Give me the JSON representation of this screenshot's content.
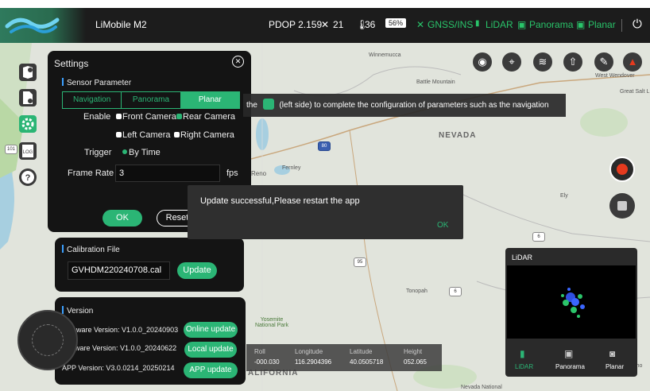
{
  "topbar": {
    "app_title": "LiMobile M2",
    "pdop": "PDOP 2.159",
    "satellites": "21",
    "temperature": "36",
    "battery": "56%",
    "gnss_label": "GNSS/INS",
    "lidar_label": "LiDAR",
    "panorama_label": "Panorama",
    "planar_label": "Planar"
  },
  "hint_banner": {
    "prefix": "the",
    "text": "(left side) to complete the configuration of parameters such as the navigation"
  },
  "settings": {
    "title": "Settings",
    "sensor_title": "Sensor Parameter",
    "tabs": [
      "Navigation",
      "Panorama",
      "Planar"
    ],
    "active_tab": "Planar",
    "enable_label": "Enable",
    "cameras": [
      {
        "label": "Front Camera",
        "checked": false
      },
      {
        "label": "Rear Camera",
        "checked": true
      },
      {
        "label": "Left Camera",
        "checked": false
      },
      {
        "label": "Right Camera",
        "checked": false
      }
    ],
    "trigger_label": "Trigger",
    "trigger_value": "By Time",
    "frame_rate_label": "Frame Rate",
    "frame_rate_value": "3",
    "frame_rate_unit": "fps",
    "ok_label": "OK",
    "reset_label": "Reset"
  },
  "calibration": {
    "title": "Calibration File",
    "file": "GVHDM220240708.cal",
    "update_label": "Update"
  },
  "version": {
    "title": "Version",
    "firmware": "Firmware Version: V1.0.0_20240903",
    "software": "Software Version: V1.0.0_20240622",
    "app": "APP Version: V3.0.0214_20250214",
    "online_update": "Online update",
    "local_update": "Local update",
    "app_update": "APP update"
  },
  "dialog": {
    "message": "Update successful,Please restart the app",
    "ok_label": "OK"
  },
  "telemetry": {
    "roll_label": "Roll",
    "roll_value": "-000.030",
    "longitude_label": "Longitude",
    "longitude_value": "116.2904396",
    "latitude_label": "Latitude",
    "latitude_value": "40.0505718",
    "height_label": "Height",
    "height_value": "052.065"
  },
  "lidar_panel": {
    "title": "LiDAR",
    "tabs": [
      "LiDAR",
      "Panorama",
      "Planar"
    ],
    "active_tab": "LiDAR"
  },
  "map_labels": {
    "winnemucca": "Winnemucca",
    "battle_mountain": "Battle Mountain",
    "west_wendover": "West Wendover",
    "great_salt": "Great Salt L",
    "nevada": "NEVADA",
    "reno": "Reno",
    "fernley": "Fernley",
    "ely": "Ely",
    "tonopah": "Tonopah",
    "yosemite": "Yosemite National Park",
    "california": "ALIFORNIA",
    "nevada_national": "Nevada National",
    "sho": "Sho",
    "route_80": "80",
    "route_95": "95",
    "route_6": "6",
    "route_101": "101"
  },
  "colors": {
    "accent": "#2bb575",
    "record": "#e53a1e",
    "info_bar": "#3ca0ff"
  },
  "icons": {
    "top": [
      "satellite-icon",
      "thermometer-icon",
      "battery-icon",
      "gnss-icon",
      "lidar-icon",
      "panorama-icon",
      "planar-icon",
      "power-icon"
    ],
    "sidebar": [
      "map-pin-icon",
      "file-settings-icon",
      "gear-icon",
      "log-icon",
      "help-icon"
    ],
    "map_tools": [
      "eye-icon",
      "location-icon",
      "layers-icon",
      "upload-icon",
      "broom-icon",
      "compass-icon"
    ]
  }
}
